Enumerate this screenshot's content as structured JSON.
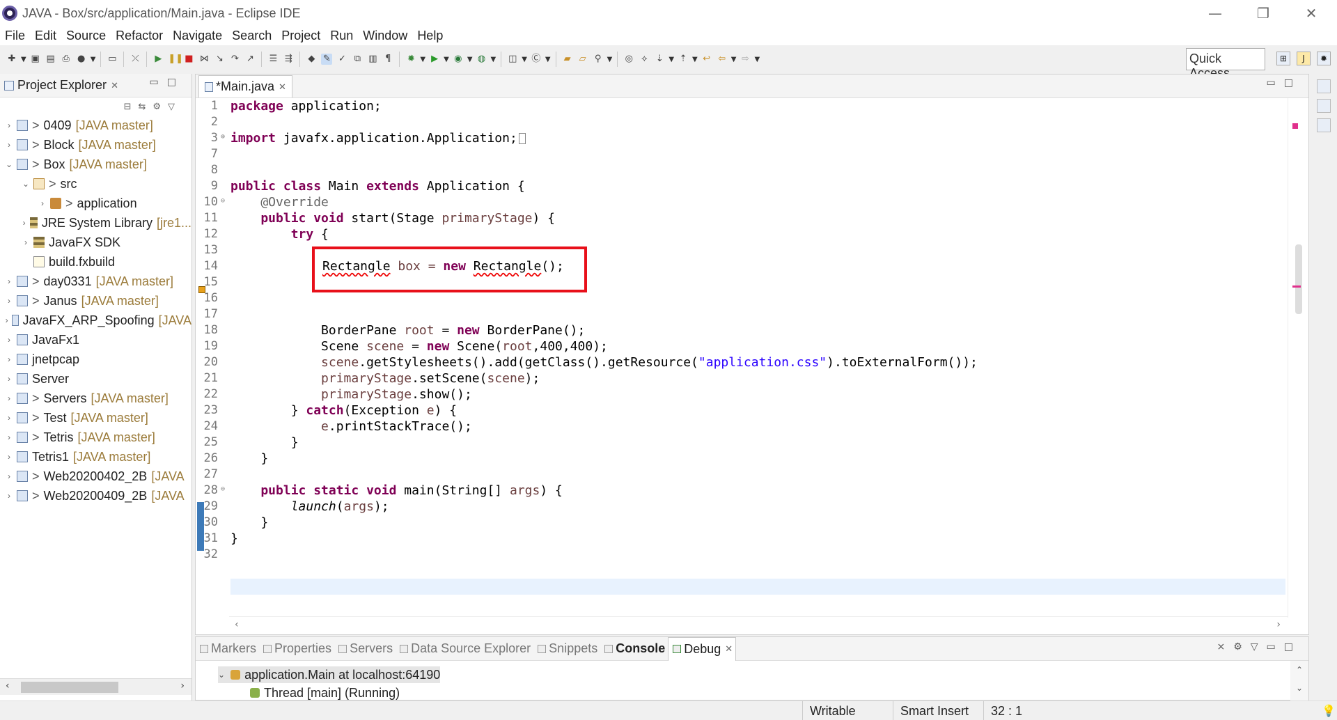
{
  "window": {
    "title": "JAVA - Box/src/application/Main.java - Eclipse IDE",
    "minimize": "—",
    "restore": "❐",
    "close": "✕"
  },
  "menu": [
    "File",
    "Edit",
    "Source",
    "Refactor",
    "Navigate",
    "Search",
    "Project",
    "Run",
    "Window",
    "Help"
  ],
  "quick_access": "Quick Access",
  "project_explorer": {
    "title": "Project Explorer",
    "nodes": [
      {
        "prefix": ">",
        "label": "0409",
        "tag": "[JAVA master]"
      },
      {
        "prefix": ">",
        "label": "Block",
        "tag": "[JAVA master]"
      },
      {
        "prefix": ">",
        "label": "Box",
        "tag": "[JAVA master]"
      },
      {
        "prefix": ">",
        "label": "src",
        "tag": ""
      },
      {
        "prefix": ">",
        "label": "application",
        "tag": ""
      },
      {
        "prefix": "",
        "label": "JRE System Library",
        "tag": "[jre1..."
      },
      {
        "prefix": "",
        "label": "JavaFX SDK",
        "tag": ""
      },
      {
        "prefix": "",
        "label": "build.fxbuild",
        "tag": ""
      },
      {
        "prefix": ">",
        "label": "day0331",
        "tag": "[JAVA master]"
      },
      {
        "prefix": ">",
        "label": "Janus",
        "tag": "[JAVA master]"
      },
      {
        "prefix": "",
        "label": "JavaFX_ARP_Spoofing",
        "tag": "[JAVA"
      },
      {
        "prefix": "",
        "label": "JavaFx1",
        "tag": ""
      },
      {
        "prefix": "",
        "label": "jnetpcap",
        "tag": ""
      },
      {
        "prefix": "",
        "label": "Server",
        "tag": ""
      },
      {
        "prefix": ">",
        "label": "Servers",
        "tag": "[JAVA master]"
      },
      {
        "prefix": ">",
        "label": "Test",
        "tag": "[JAVA master]"
      },
      {
        "prefix": ">",
        "label": "Tetris",
        "tag": "[JAVA master]"
      },
      {
        "prefix": "",
        "label": "Tetris1",
        "tag": "[JAVA master]"
      },
      {
        "prefix": ">",
        "label": "Web20200402_2B",
        "tag": "[JAVA"
      },
      {
        "prefix": ">",
        "label": "Web20200409_2B",
        "tag": "[JAVA"
      }
    ]
  },
  "editor": {
    "tab_label": "*Main.java",
    "line_numbers": [
      "1",
      "2",
      "3",
      "7",
      "8",
      "9",
      "10",
      "11",
      "12",
      "13",
      "14",
      "15",
      "16",
      "17",
      "18",
      "19",
      "20",
      "21",
      "22",
      "23",
      "24",
      "25",
      "26",
      "27",
      "28",
      "29",
      "30",
      "31",
      "32"
    ],
    "code": {
      "l1_kw": "package",
      "l1_rest": " application;",
      "l3_kw": "import",
      "l3_rest": " javafx.application.Application;",
      "l9_kw1": "public",
      "l9_kw2": "class",
      "l9_name": " Main ",
      "l9_kw3": "extends",
      "l9_rest": " Application {",
      "l10": "    @Override",
      "l11_kw1": "    public",
      "l11_kw2": " void",
      "l11_mid": " start(Stage ",
      "l11_param": "primaryStage",
      "l11_end": ") {",
      "l12_kw": "        try",
      "l12_end": " {",
      "l14_type": "Rectangle",
      "l14_var": " box = ",
      "l14_kw": "new",
      "l14_ctor": "Rectangle",
      "l14_end": "();",
      "l18_a": "            BorderPane ",
      "l18_b": "root",
      "l18_c": " = ",
      "l18_kw": "new",
      "l18_d": " BorderPane();",
      "l19_a": "            Scene ",
      "l19_b": "scene",
      "l19_c": " = ",
      "l19_kw": "new",
      "l19_d": " Scene(",
      "l19_e": "root",
      "l19_f": ",400,400);",
      "l20_a": "            ",
      "l20_b": "scene",
      "l20_c": ".getStylesheets().add(getClass().getResource(",
      "l20_str": "\"application.css\"",
      "l20_d": ").toExternalForm());",
      "l21_a": "            ",
      "l21_b": "primaryStage",
      "l21_c": ".setScene(",
      "l21_d": "scene",
      "l21_e": ");",
      "l22_a": "            ",
      "l22_b": "primaryStage",
      "l22_c": ".show();",
      "l23_a": "        } ",
      "l23_kw": "catch",
      "l23_b": "(Exception ",
      "l23_c": "e",
      "l23_d": ") {",
      "l24_a": "            ",
      "l24_b": "e",
      "l24_c": ".printStackTrace();",
      "l25": "        }",
      "l26": "    }",
      "l28_kw1": "    public",
      "l28_kw2": " static",
      "l28_kw3": " void",
      "l28_mid": " main(String[] ",
      "l28_param": "args",
      "l28_end": ") {",
      "l29_a": "        ",
      "l29_b": "launch",
      "l29_c": "(",
      "l29_d": "args",
      "l29_e": ");",
      "l30": "    }",
      "l31": "}"
    }
  },
  "bottom_panel": {
    "tabs": [
      "Markers",
      "Properties",
      "Servers",
      "Data Source Explorer",
      "Snippets",
      "Console",
      "Debug"
    ],
    "rows": [
      "application.Main at localhost:64190",
      "Thread [main] (Running)"
    ]
  },
  "status_bar": {
    "mode": "Writable",
    "insert": "Smart Insert",
    "position": "32 : 1"
  }
}
